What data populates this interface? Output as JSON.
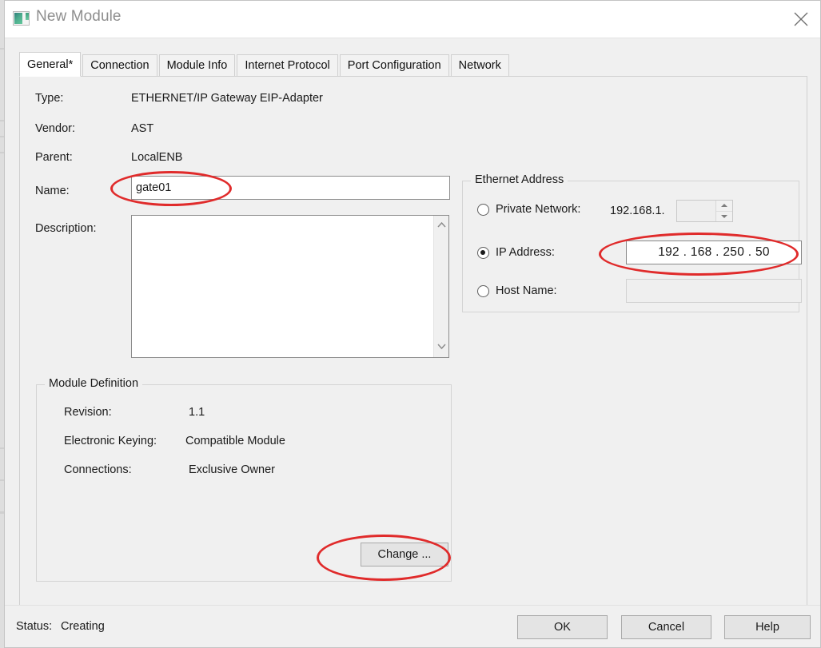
{
  "window": {
    "title": "New Module",
    "icon": "module-icon",
    "close_icon": "close-icon"
  },
  "tabs": [
    {
      "label": "General*",
      "active": true
    },
    {
      "label": "Connection",
      "active": false
    },
    {
      "label": "Module Info",
      "active": false
    },
    {
      "label": "Internet Protocol",
      "active": false
    },
    {
      "label": "Port Configuration",
      "active": false
    },
    {
      "label": "Network",
      "active": false
    }
  ],
  "general": {
    "type_label": "Type:",
    "type_value": "ETHERNET/IP Gateway EIP-Adapter",
    "vendor_label": "Vendor:",
    "vendor_value": "AST",
    "parent_label": "Parent:",
    "parent_value": "LocalENB",
    "name_label": "Name:",
    "name_value": "gate01",
    "description_label": "Description:",
    "description_value": "",
    "description_scroll_up_icon": "chevron-up-icon",
    "description_scroll_down_icon": "chevron-down-icon"
  },
  "ethernet": {
    "group_title": "Ethernet Address",
    "private_network_label": "Private Network:",
    "private_network_prefix": "192.168.1.",
    "private_network_value": "",
    "private_network_selected": false,
    "spinner_up_icon": "spinner-up-icon",
    "spinner_down_icon": "spinner-down-icon",
    "ip_address_label": "IP Address:",
    "ip_address_selected": true,
    "ip_octets": [
      "192",
      "168",
      "250",
      "50"
    ],
    "ip_address_value": "192 . 168 . 250 .  50",
    "host_name_label": "Host Name:",
    "host_name_value": "",
    "host_name_selected": false
  },
  "module_definition": {
    "group_title": "Module Definition",
    "revision_label": "Revision:",
    "revision_value": "1.1",
    "keying_label": "Electronic Keying:",
    "keying_value": "Compatible Module",
    "connections_label": "Connections:",
    "connections_value": "Exclusive Owner",
    "change_button": "Change ..."
  },
  "footer": {
    "status_label": "Status:",
    "status_value": "Creating",
    "ok_button": "OK",
    "cancel_button": "Cancel",
    "help_button": "Help"
  },
  "annotations": {
    "color": "#e02b2b",
    "items": [
      {
        "name": "name-field-highlight"
      },
      {
        "name": "ip-address-highlight"
      },
      {
        "name": "change-button-highlight"
      }
    ]
  }
}
